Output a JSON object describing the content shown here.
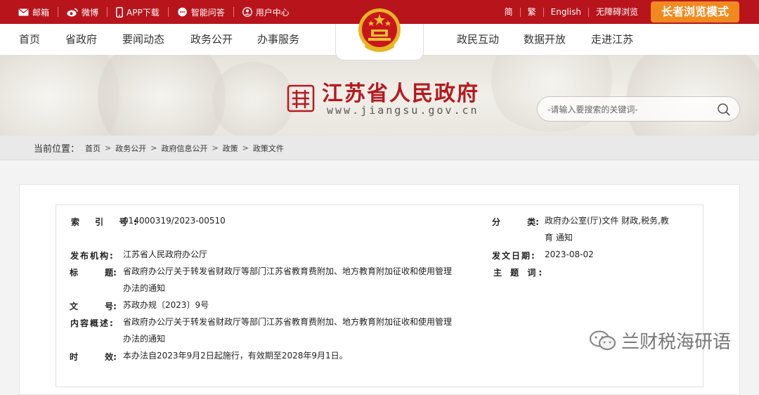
{
  "topbar": {
    "items": [
      {
        "icon": "mail-icon",
        "label": "邮箱"
      },
      {
        "icon": "weibo-icon",
        "label": "微博"
      },
      {
        "icon": "phone-icon",
        "label": "APP下载"
      },
      {
        "icon": "chat-icon",
        "label": "智能问答"
      },
      {
        "icon": "user-icon",
        "label": "用户中心"
      }
    ],
    "right_links": [
      "简",
      "繁",
      "English",
      "无障碍浏览"
    ],
    "elder_mode": "长者浏览模式",
    "bar_color": "#b8141c",
    "elder_color": "#f08a1e"
  },
  "nav": {
    "left": [
      "首页",
      "省政府",
      "要闻动态",
      "政务公开",
      "办事服务"
    ],
    "right": [
      "政民互动",
      "数据开放",
      "走进江苏"
    ]
  },
  "banner": {
    "site_name": "江苏省人民政府",
    "site_url": "www.jiangsu.gov.cn",
    "search_placeholder": "-请输入要搜索的关键词-",
    "brand_color": "#b51a1f"
  },
  "breadcrumb": {
    "label": "当前位置：",
    "items": [
      "首页",
      "政务公开",
      "政府信息公开",
      "政策",
      "政策文件"
    ]
  },
  "info": {
    "index_label": "索 引 号:",
    "index_value": "014000319/2023-00510",
    "category_label": "分 类:",
    "category_value_1": "政府办公室(厅)文件 财政,税务,教",
    "category_value_2": "育 通知",
    "publisher_label": "发布机构:",
    "publisher_value": "江苏省人民政府办公厅",
    "date_label": "发文日期:",
    "date_value": "2023-08-02",
    "title_label": "标 题:",
    "title_value_1": "省政府办公厅关于转发省财政厅等部门江苏省教育费附加、地方教育附加征收和使用管理",
    "title_value_2": "办法的通知",
    "subject_label": "主 题 词:",
    "subject_value": "",
    "docno_label": "文 号:",
    "docno_value": "苏政办规〔2023〕9号",
    "summary_label": "内容概述:",
    "summary_value_1": "省政府办公厅关于转发省财政厅等部门江苏省教育费附加、地方教育附加征收和使用管理",
    "summary_value_2": "办法的通知",
    "validity_label": "时 效:",
    "validity_value": "本办法自2023年9月2日起施行，有效期至2028年9月1日。"
  },
  "watermark": {
    "icon": "wechat-icon",
    "text": "兰财税海研语"
  }
}
